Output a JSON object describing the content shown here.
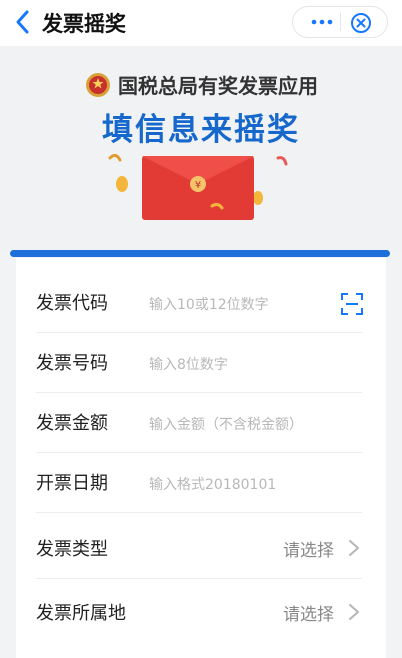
{
  "nav": {
    "title": "发票摇奖",
    "back_icon": "chevron-left-icon",
    "more_icon": "more-dots-icon",
    "close_icon": "close-circle-icon"
  },
  "hero": {
    "app_name": "国税总局有奖发票应用",
    "title": "填信息来摇奖",
    "emblem_icon": "national-emblem-icon",
    "envelope_icon": "red-envelope-icon",
    "envelope_symbol": "¥"
  },
  "form": {
    "rows": [
      {
        "label": "发票代码",
        "placeholder": "输入10或12位数字",
        "action_icon": "scan-icon"
      },
      {
        "label": "发票号码",
        "placeholder": "输入8位数字"
      },
      {
        "label": "发票金额",
        "placeholder": "输入金额（不含税金额）"
      },
      {
        "label": "开票日期",
        "placeholder": "输入格式20180101"
      },
      {
        "label": "发票类型",
        "select": "请选择"
      },
      {
        "label": "发票所属地",
        "select": "请选择"
      }
    ]
  },
  "colors": {
    "accent": "#1e6fd9",
    "title_blue": "#1668cc",
    "envelope_red": "#e23b36"
  }
}
